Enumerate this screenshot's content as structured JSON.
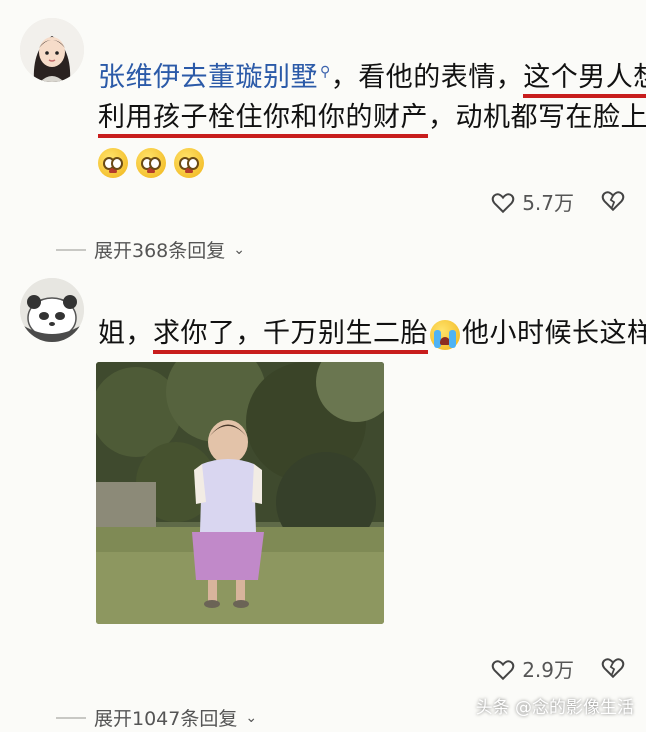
{
  "comment1": {
    "username": "张维伊去董璇别墅",
    "text_part1": "，看他的表情，",
    "text_underlined1": "这个男人想",
    "text_underlined2": "利用孩子栓住你和你的财产",
    "text_part2": "，动机都写在脸上了",
    "emojis": [
      "pleading-face-icon",
      "pleading-face-icon",
      "pleading-face-icon"
    ],
    "likes": "5.7万",
    "replies": "展开368条回复"
  },
  "comment2": {
    "text_part1": "姐，",
    "text_underlined": "求你了，千万别生二胎",
    "text_part2": "他小时候长这样",
    "emoji": "crying-face-icon",
    "likes": "2.9万",
    "replies": "展开1047条回复"
  },
  "watermark": "头条 @念的影像生活"
}
